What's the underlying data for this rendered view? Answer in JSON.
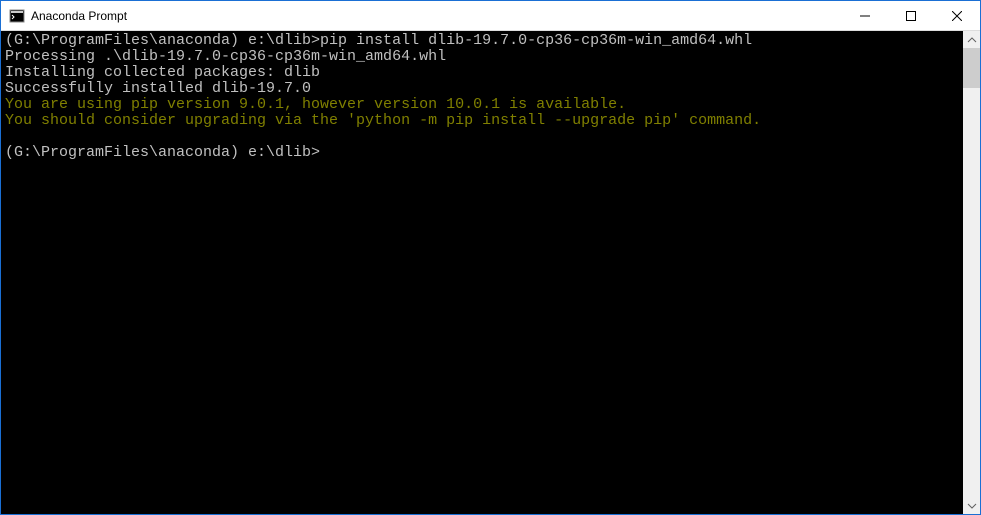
{
  "window": {
    "title": "Anaconda Prompt"
  },
  "terminal": {
    "lines": [
      {
        "type": "prompt",
        "prompt": "(G:\\ProgramFiles\\anaconda) e:\\dlib>",
        "cmd": "pip install dlib-19.7.0-cp36-cp36m-win_amd64.whl"
      },
      {
        "type": "plain",
        "text": "Processing .\\dlib-19.7.0-cp36-cp36m-win_amd64.whl"
      },
      {
        "type": "plain",
        "text": "Installing collected packages: dlib"
      },
      {
        "type": "plain",
        "text": "Successfully installed dlib-19.7.0"
      },
      {
        "type": "yellow",
        "text": "You are using pip version 9.0.1, however version 10.0.1 is available."
      },
      {
        "type": "yellow",
        "text": "You should consider upgrading via the 'python -m pip install --upgrade pip' command."
      },
      {
        "type": "blank",
        "text": ""
      },
      {
        "type": "prompt-cursor",
        "prompt": "(G:\\ProgramFiles\\anaconda) e:\\dlib>",
        "cmd": ""
      }
    ]
  }
}
